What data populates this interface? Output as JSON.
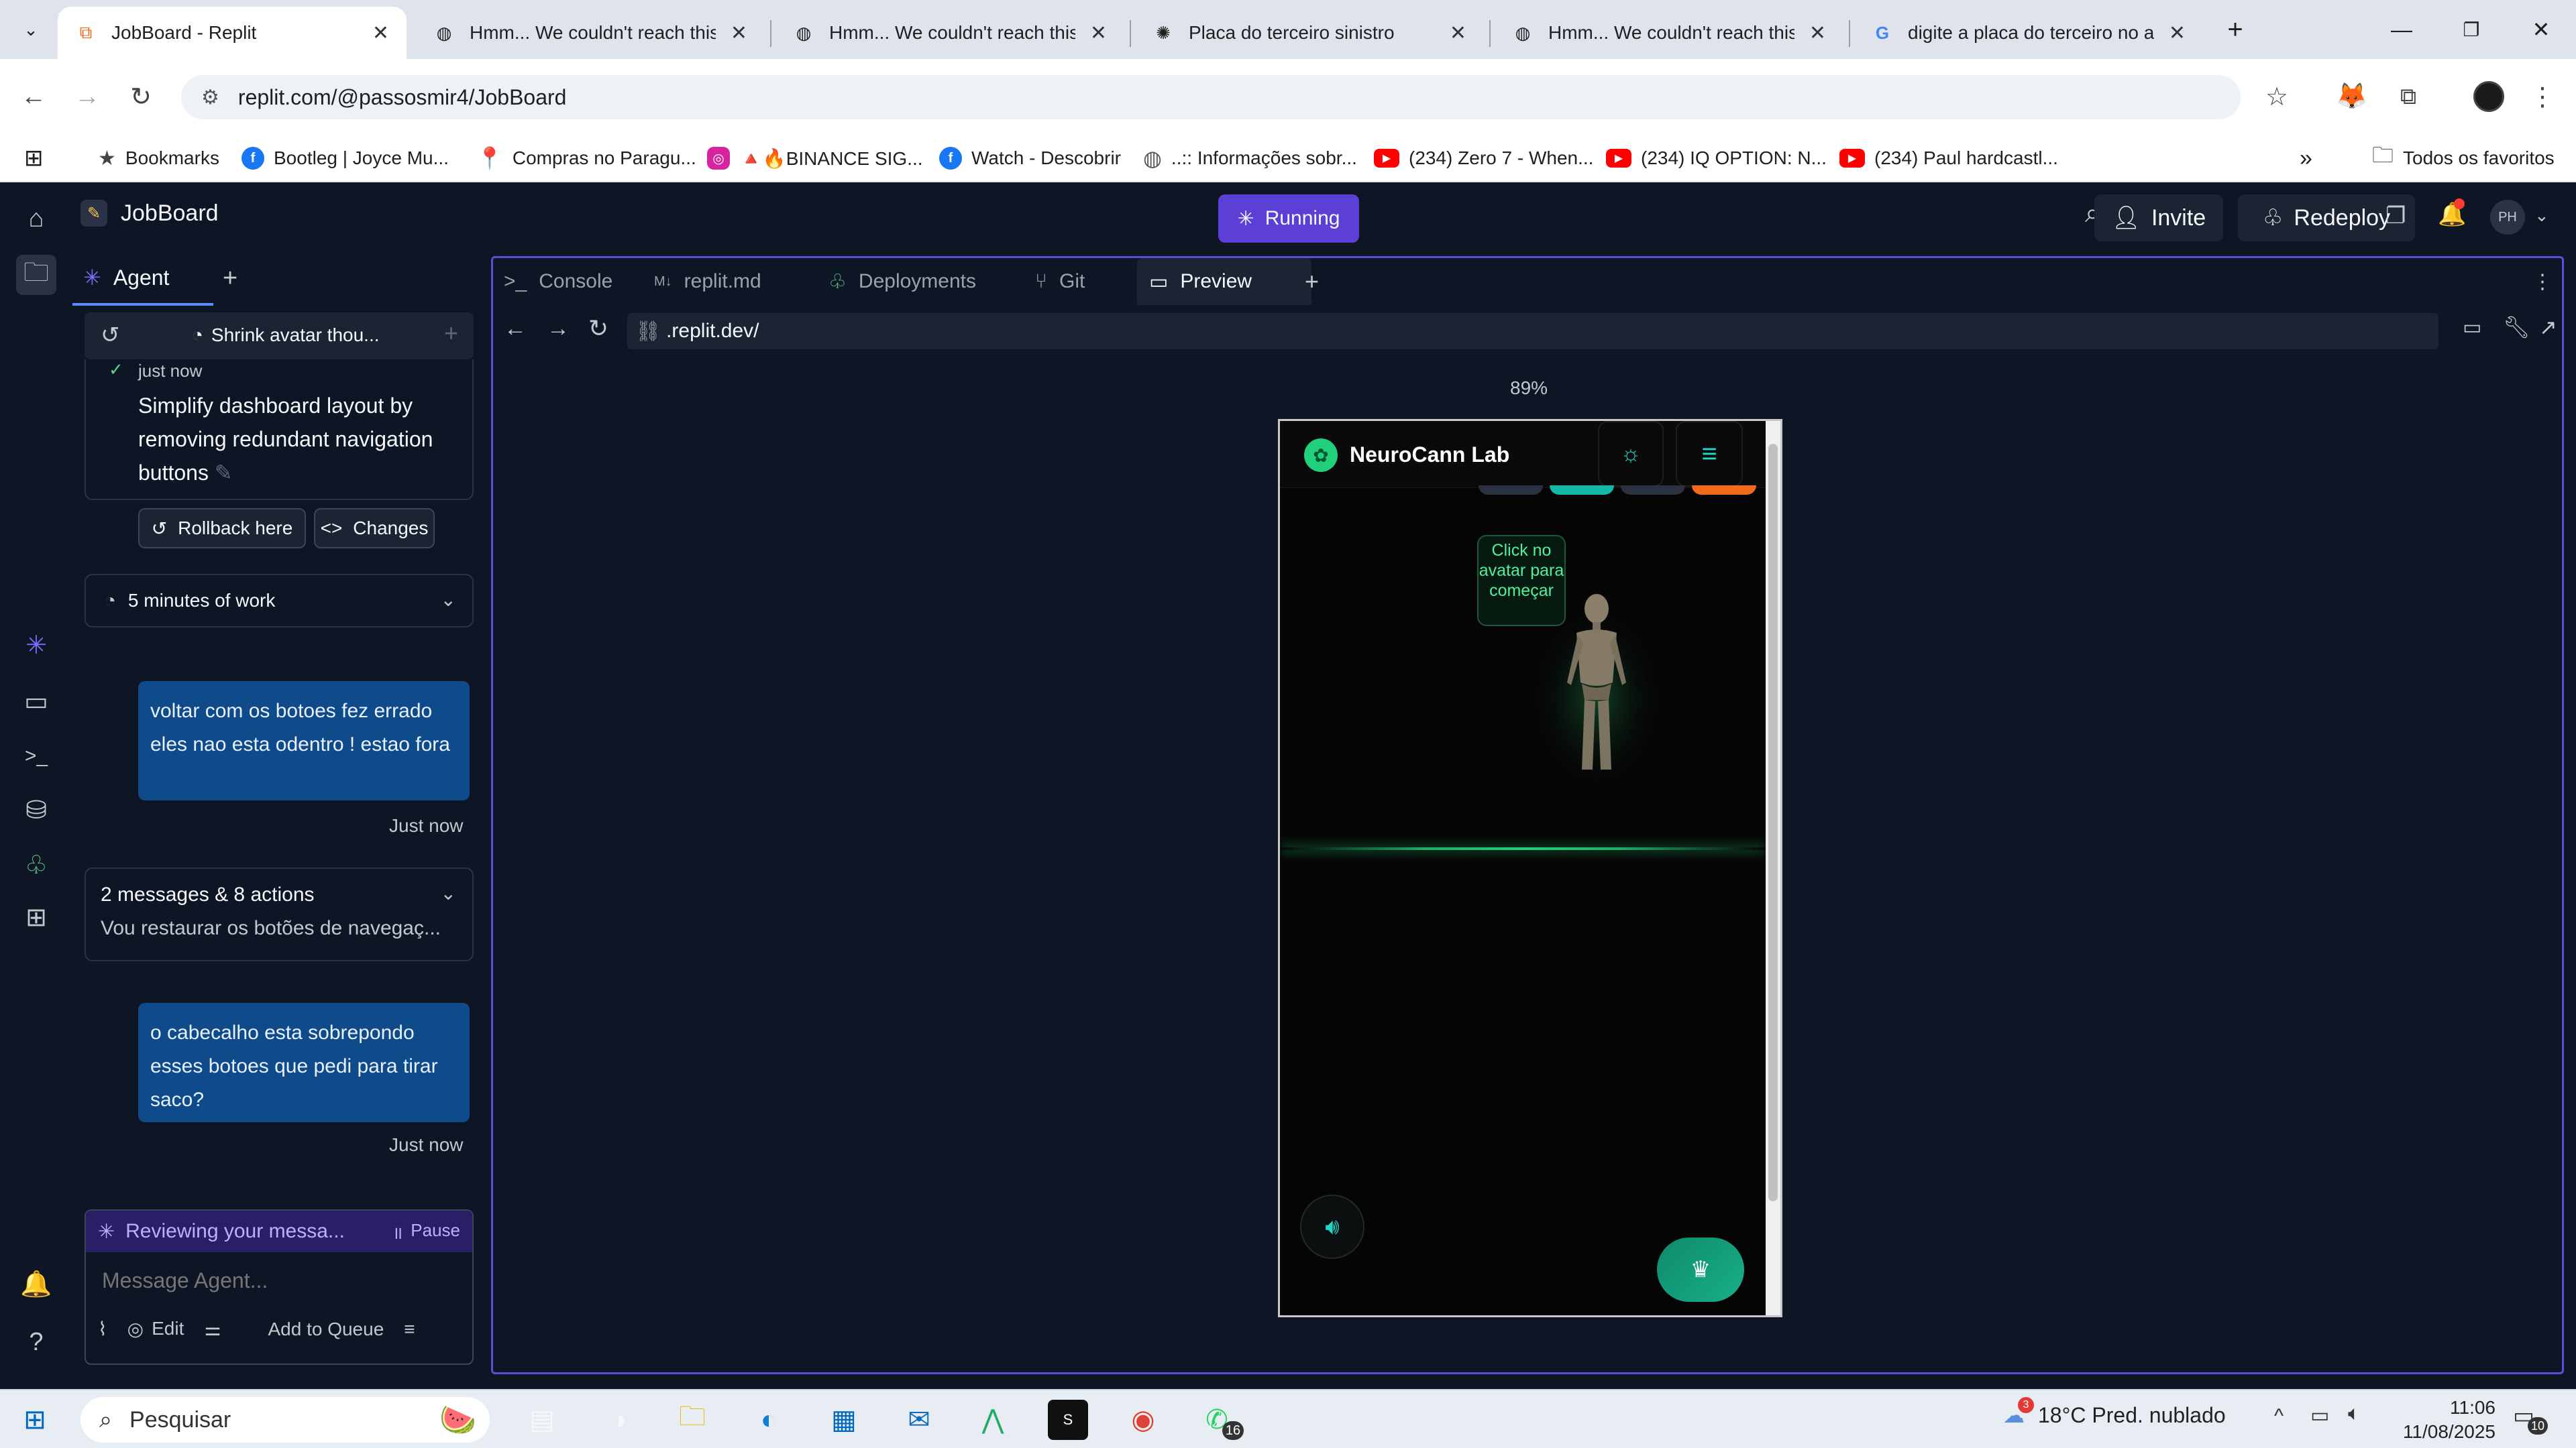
{
  "browser": {
    "tabs": [
      {
        "title": "JobBoard - Replit",
        "icon": "replit-icon",
        "active": true
      },
      {
        "title": "Hmm... We couldn't reach this a",
        "icon": "globe-icon"
      },
      {
        "title": "Hmm... We couldn't reach this a",
        "icon": "globe-icon"
      },
      {
        "title": "Placa do terceiro sinistro",
        "icon": "openai-icon"
      },
      {
        "title": "Hmm... We couldn't reach this a",
        "icon": "globe-icon"
      },
      {
        "title": "digite a placa do terceiro no azu",
        "icon": "google-icon"
      }
    ],
    "url": "replit.com/@passosmir4/JobBoard",
    "bookmarks": [
      {
        "label": "Bookmarks",
        "icon": "star-icon",
        "color": "#444444"
      },
      {
        "label": "Bootleg | Joyce Mu...",
        "icon": "facebook-icon",
        "color": "#1877f2"
      },
      {
        "label": "Compras no Paragu...",
        "icon": "map-pin-icon",
        "color": "#e22a1f"
      },
      {
        "label": "🔺🔥BINANCE SIG...",
        "icon": "instagram-icon",
        "color": "#d6249f"
      },
      {
        "label": "Watch - Descobrir",
        "icon": "facebook-icon",
        "color": "#1877f2"
      },
      {
        "label": "..:: Informações sobr...",
        "icon": "globe-icon",
        "color": "#666666"
      },
      {
        "label": "(234) Zero 7 - When...",
        "icon": "youtube-icon",
        "color": "#ff0000"
      },
      {
        "label": "(234) IQ OPTION: N...",
        "icon": "youtube-icon",
        "color": "#ff0000"
      },
      {
        "label": "(234) Paul hardcastl...",
        "icon": "youtube-icon",
        "color": "#ff0000"
      }
    ],
    "all_bookmarks": "Todos os favoritos"
  },
  "replit": {
    "project": "JobBoard",
    "run_status": "Running",
    "invite": "Invite",
    "redeploy": "Redeploy",
    "avatar_initials": "PH",
    "agent_tab": "Agent",
    "chat_title": "Shrink avatar thou...",
    "checkpoint": {
      "time": "just now",
      "message": "Simplify dashboard layout by removing redundant navigation buttons",
      "rollback": "Rollback here",
      "changes": "Changes"
    },
    "work_summary": "5 minutes of work",
    "messages": [
      {
        "text": "voltar com os botoes fez errado eles nao esta odentro ! estao fora",
        "time": "Just now"
      },
      {
        "text": "o cabecalho esta sobrepondo esses botoes que pedi para tirar saco?",
        "time": "Just now"
      }
    ],
    "actions_summary": {
      "title": "2 messages & 8 actions",
      "preview": "Vou restaurar os botões de navegaç..."
    },
    "status": {
      "text": "Reviewing your messa...",
      "pause": "Pause"
    },
    "input": {
      "placeholder": "Message Agent...",
      "edit": "Edit",
      "queue": "Add to Queue"
    },
    "workspace_tabs": [
      {
        "label": "Console",
        "icon": "terminal-icon"
      },
      {
        "label": "replit.md",
        "icon": "markdown-icon"
      },
      {
        "label": "Deployments",
        "icon": "deploy-icon"
      },
      {
        "label": "Git",
        "icon": "git-icon"
      },
      {
        "label": "Preview",
        "icon": "monitor-icon",
        "active": true
      }
    ],
    "preview_url": ".replit.dev/",
    "zoom": "89%"
  },
  "preview_app": {
    "brand": "NeuroCann Lab",
    "tooltip": "Click no avatar para começar",
    "accent": "#21d07a"
  },
  "taskbar": {
    "search": "Pesquisar",
    "weather": "18°C  Pred. nublado",
    "time": "11:06",
    "date": "11/08/2025",
    "whatsapp_badge": "16",
    "notif_badge": "10",
    "weather_badge": "3"
  }
}
